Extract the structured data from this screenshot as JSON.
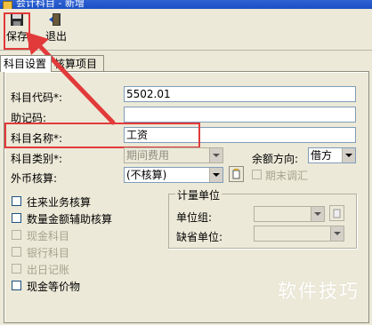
{
  "window": {
    "title": "会计科目 - 新增"
  },
  "toolbar": {
    "save_label": "保存",
    "exit_label": "退出"
  },
  "tabs": [
    {
      "label": "科目设置",
      "active": true
    },
    {
      "label": "核算项目",
      "active": false
    }
  ],
  "form": {
    "code_label": "科目代码*:",
    "code_value": "5502.01",
    "mnemonic_label": "助记码:",
    "mnemonic_value": "",
    "name_label": "科目名称*:",
    "name_value": "工资",
    "category_label": "科目类别*:",
    "category_value": "期间费用",
    "balance_label": "余额方向:",
    "balance_value": "借方",
    "currency_label": "外币核算:",
    "currency_value": "(不核算)",
    "period_adjust_label": "期末调汇"
  },
  "checkboxes": [
    {
      "label": "往来业务核算",
      "enabled": true
    },
    {
      "label": "数量金额辅助核算",
      "enabled": true
    },
    {
      "label": "现金科目",
      "enabled": false
    },
    {
      "label": "银行科目",
      "enabled": false
    },
    {
      "label": "出日记账",
      "enabled": false
    },
    {
      "label": "现金等价物",
      "enabled": true
    }
  ],
  "unit_group": {
    "title": "计量单位",
    "group_label": "单位组:",
    "default_label": "缺省单位:"
  },
  "watermark": "软件技巧",
  "colors": {
    "highlight": "#e23a3a",
    "title_bar": "#1a4fc4"
  }
}
